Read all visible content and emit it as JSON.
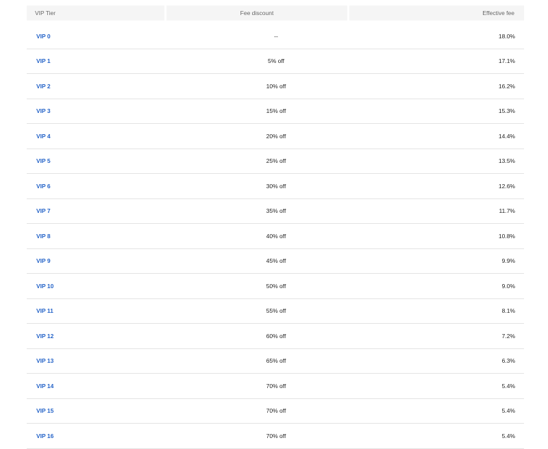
{
  "table": {
    "headers": {
      "tier": "VIP Tier",
      "discount": "Fee discount",
      "fee": "Effective fee"
    },
    "rows": [
      {
        "tier": "VIP 0",
        "discount": "--",
        "fee": "18.0%"
      },
      {
        "tier": "VIP 1",
        "discount": "5% off",
        "fee": "17.1%"
      },
      {
        "tier": "VIP 2",
        "discount": "10% off",
        "fee": "16.2%"
      },
      {
        "tier": "VIP 3",
        "discount": "15% off",
        "fee": "15.3%"
      },
      {
        "tier": "VIP 4",
        "discount": "20% off",
        "fee": "14.4%"
      },
      {
        "tier": "VIP 5",
        "discount": "25% off",
        "fee": "13.5%"
      },
      {
        "tier": "VIP 6",
        "discount": "30% off",
        "fee": "12.6%"
      },
      {
        "tier": "VIP 7",
        "discount": "35% off",
        "fee": "11.7%"
      },
      {
        "tier": "VIP 8",
        "discount": "40% off",
        "fee": "10.8%"
      },
      {
        "tier": "VIP 9",
        "discount": "45% off",
        "fee": "9.9%"
      },
      {
        "tier": "VIP 10",
        "discount": "50% off",
        "fee": "9.0%"
      },
      {
        "tier": "VIP 11",
        "discount": "55% off",
        "fee": "8.1%"
      },
      {
        "tier": "VIP 12",
        "discount": "60% off",
        "fee": "7.2%"
      },
      {
        "tier": "VIP 13",
        "discount": "65% off",
        "fee": "6.3%"
      },
      {
        "tier": "VIP 14",
        "discount": "70% off",
        "fee": "5.4%"
      },
      {
        "tier": "VIP 15",
        "discount": "70% off",
        "fee": "5.4%"
      },
      {
        "tier": "VIP 16",
        "discount": "70% off",
        "fee": "5.4%"
      }
    ]
  },
  "colors": {
    "link": "#2463c8",
    "header_bg": "#f5f5f5",
    "header_text": "#666666",
    "row_border": "#e3e3e3"
  }
}
